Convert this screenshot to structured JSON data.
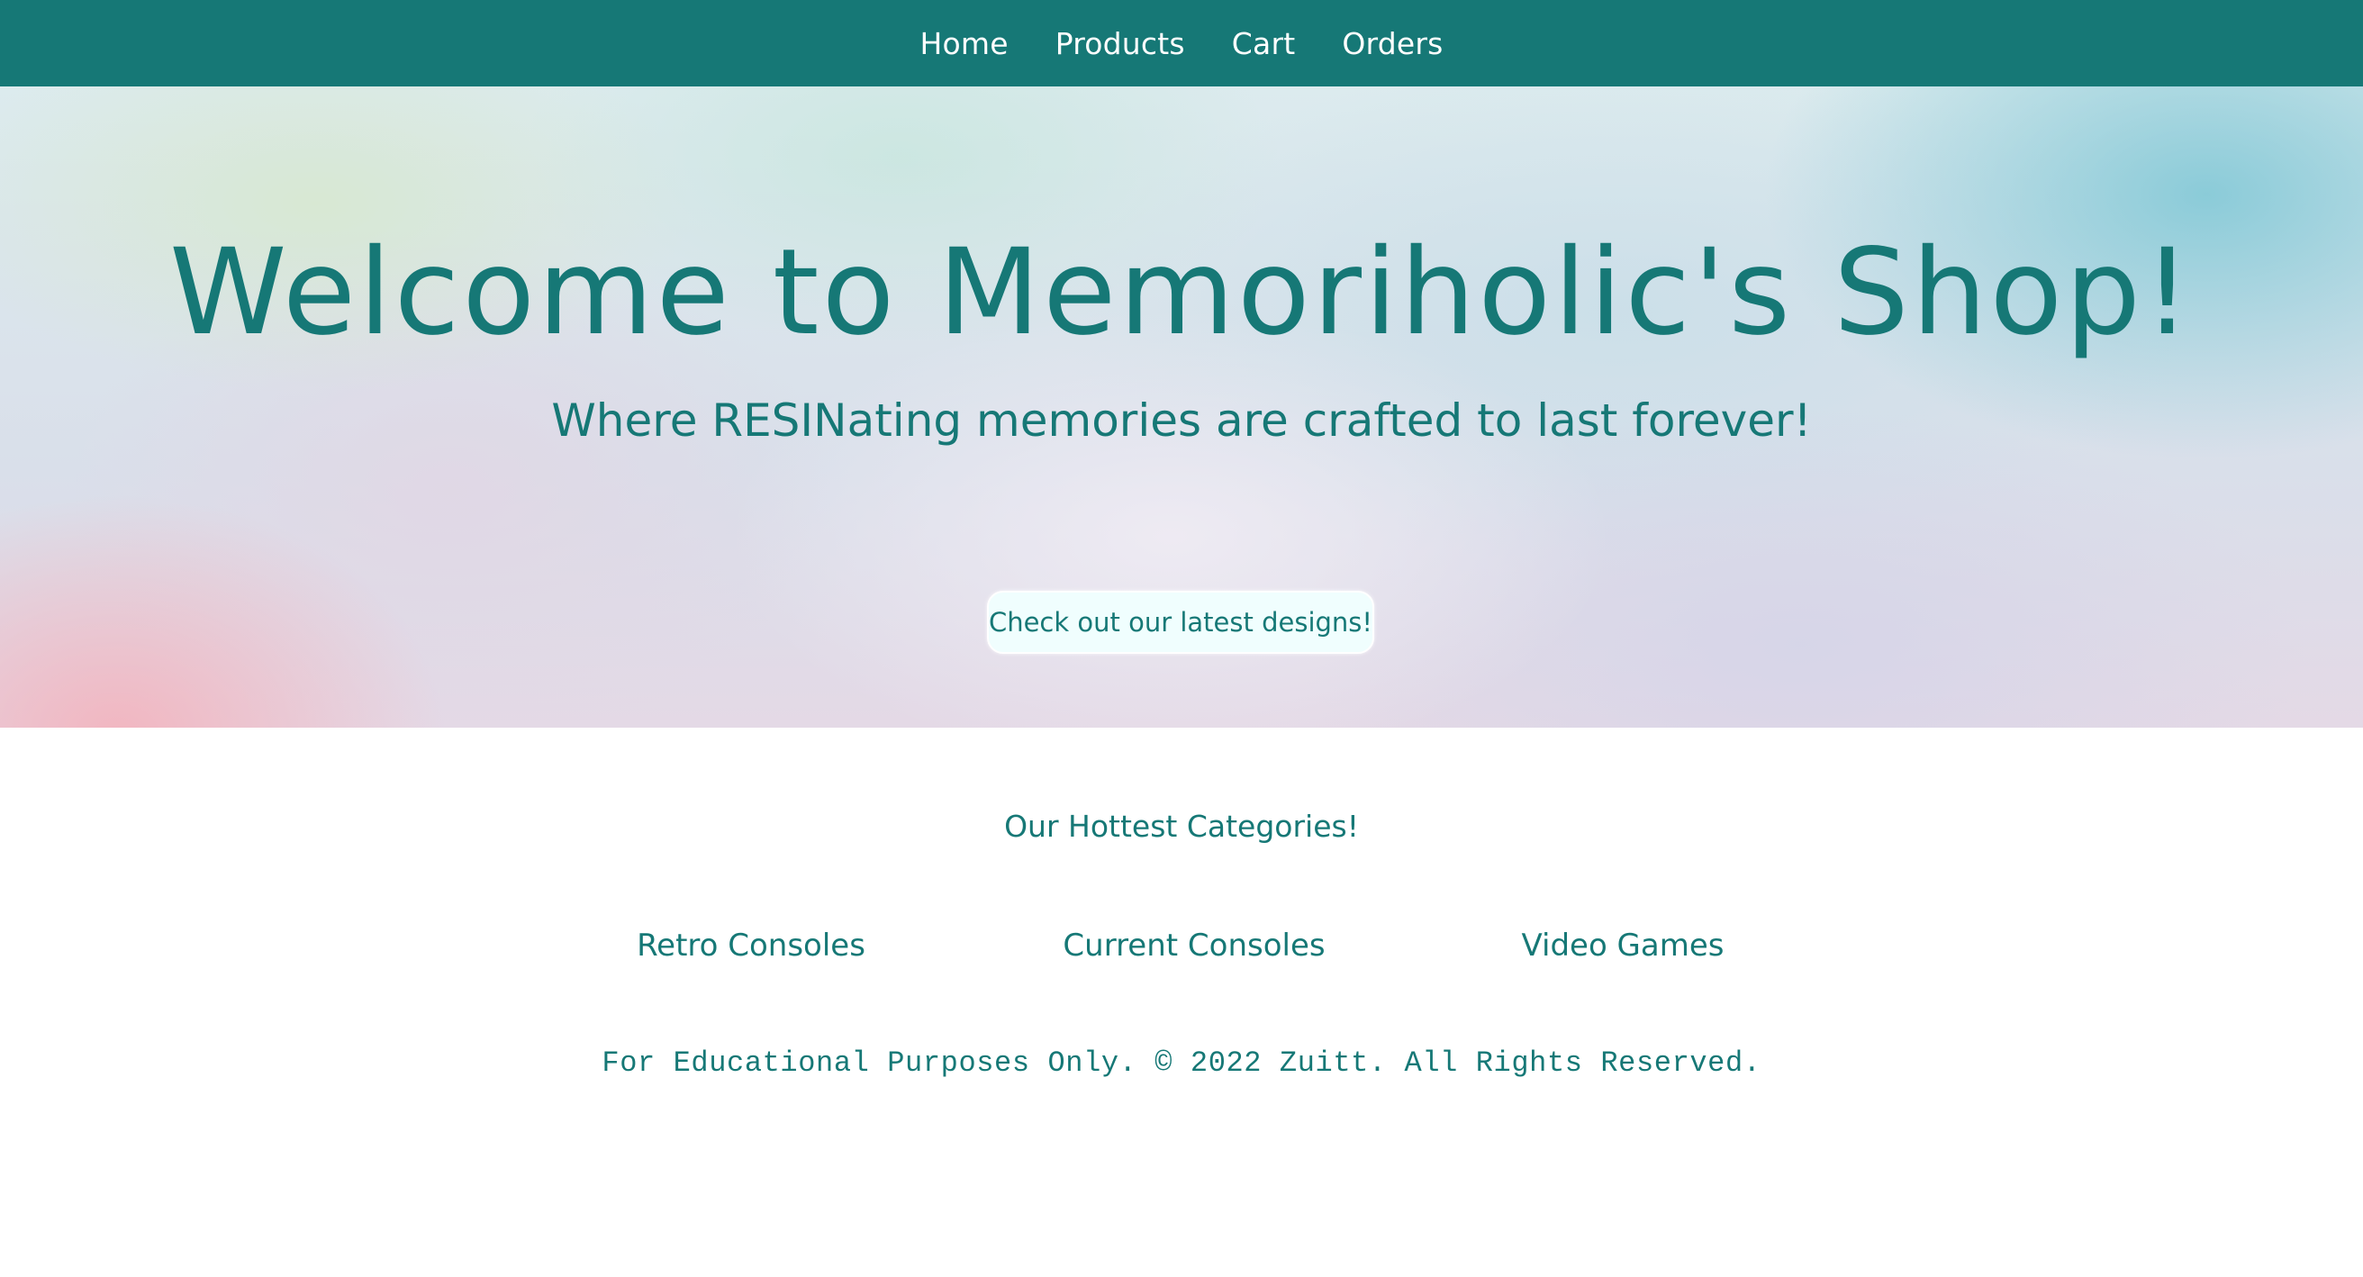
{
  "navbar": {
    "links": [
      {
        "label": "Home"
      },
      {
        "label": "Products"
      },
      {
        "label": "Cart"
      },
      {
        "label": "Orders"
      }
    ]
  },
  "hero": {
    "title": "Welcome to Memoriholic's Shop!",
    "subtitle": "Where RESINating memories are crafted to last forever!",
    "cta_label": "Check out our latest designs!"
  },
  "categories": {
    "heading": "Our Hottest Categories!",
    "items": [
      {
        "label": "Retro Consoles"
      },
      {
        "label": "Current Consoles"
      },
      {
        "label": "Video Games"
      }
    ]
  },
  "footer": {
    "text": "For Educational Purposes Only. © 2022 Zuitt. All Rights Reserved."
  },
  "colors": {
    "brand": "#167876",
    "button_bg": "#f0fefe",
    "page_bg": "#ffffff"
  }
}
